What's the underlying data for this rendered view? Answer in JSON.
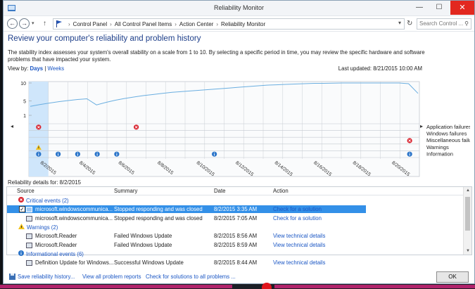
{
  "window": {
    "title": "Reliability Monitor",
    "minimize": "—",
    "maximize": "☐",
    "close": "✕"
  },
  "nav": {
    "back": "←",
    "forward": "→",
    "up": "↑",
    "breadcrumbs": [
      "Control Panel",
      "All Control Panel Items",
      "Action Center",
      "Reliability Monitor"
    ],
    "breadcrumb_sep": "›",
    "search_placeholder": "Search Control ..."
  },
  "header": {
    "title": "Review your computer's reliability and problem history",
    "description": "The stability index assesses your system's overall stability on a scale from 1 to 10. By selecting a specific period in time, you may review the specific hardware and software problems that have impacted your system.",
    "view_by_label": "View by:",
    "view_days": "Days",
    "view_sep": "|",
    "view_weeks": "Weeks",
    "last_updated": "Last updated: 8/21/2015 10:00 AM"
  },
  "chart_data": {
    "type": "line",
    "y_ticks": [
      "10",
      "5",
      "1"
    ],
    "ylim": [
      1,
      10
    ],
    "x_labels": [
      "8/2/2015",
      "8/4/2015",
      "8/6/2015",
      "8/8/2015",
      "8/10/2015",
      "8/12/2015",
      "8/14/2015",
      "8/16/2015",
      "8/18/2015",
      "8/20/2015"
    ],
    "days": 20,
    "series": [
      {
        "values": [
          3.5,
          4.0,
          4.4,
          4.8,
          5.1,
          5.4,
          5.6,
          3.9,
          4.6,
          5.2,
          5.7,
          6.1,
          6.5,
          6.8,
          7.1,
          7.4,
          7.6,
          7.8,
          8.0,
          8.2,
          8.4,
          8.6,
          8.8,
          9.0,
          9.2,
          9.4,
          9.5,
          9.6,
          9.7,
          9.8,
          9.9,
          9.9,
          9.95,
          10.0,
          10.0,
          10.0,
          10.0,
          10.0,
          10.0,
          10.0,
          9.8,
          7.1
        ]
      }
    ],
    "rows": [
      "Application failures",
      "Windows failures",
      "Miscellaneous failures",
      "Warnings",
      "Information"
    ],
    "events": [
      {
        "day": 0,
        "row": 0,
        "kind": "critical"
      },
      {
        "day": 5,
        "row": 0,
        "kind": "critical"
      },
      {
        "day": 19,
        "row": 2,
        "kind": "critical"
      },
      {
        "day": 0,
        "row": 3,
        "kind": "warning"
      },
      {
        "day": 0,
        "row": 4,
        "kind": "info"
      },
      {
        "day": 1,
        "row": 4,
        "kind": "info"
      },
      {
        "day": 2,
        "row": 4,
        "kind": "info"
      },
      {
        "day": 3,
        "row": 4,
        "kind": "info"
      },
      {
        "day": 4,
        "row": 4,
        "kind": "info"
      },
      {
        "day": 9,
        "row": 4,
        "kind": "info"
      },
      {
        "day": 19,
        "row": 4,
        "kind": "info"
      }
    ],
    "selected_day": 0,
    "left_arrow": "◂",
    "right_arrow": "▸",
    "colors": {
      "line": "#6aaee0",
      "selected": "#cfe6fb",
      "grid": "#c4c9cf",
      "critical": "#d9232e",
      "warning": "#f2c21a",
      "info": "#2a74c9"
    }
  },
  "details": {
    "title": "Reliability details for: 8/2/2015",
    "columns": [
      "Source",
      "Summary",
      "Date",
      "Action"
    ],
    "groups": [
      {
        "label": "Critical events (2)",
        "icon": "critical",
        "rows": [
          {
            "source": "microsoft.windowscommunica...",
            "summary": "Stopped responding and was closed",
            "date": "8/2/2015 3:35 AM",
            "action": "Check for a solution",
            "selected": true
          },
          {
            "source": "microsoft.windowscommunica...",
            "summary": "Stopped responding and was closed",
            "date": "8/2/2015 7:05 AM",
            "action": "Check for a solution"
          }
        ]
      },
      {
        "label": "Warnings (2)",
        "icon": "warning",
        "rows": [
          {
            "source": "Microsoft.Reader",
            "summary": "Failed Windows Update",
            "date": "8/2/2015 8:56 AM",
            "action": "View  technical details"
          },
          {
            "source": "Microsoft.Reader",
            "summary": "Failed Windows Update",
            "date": "8/2/2015 8:59 AM",
            "action": "View  technical details"
          }
        ]
      },
      {
        "label": "Informational events (6)",
        "icon": "info",
        "rows": [
          {
            "source": "Definition Update for Windows...",
            "summary": "Successful Windows Update",
            "date": "8/2/2015 8:44 AM",
            "action": "View  technical details"
          }
        ]
      }
    ]
  },
  "footer": {
    "save_history": "Save reliability history...",
    "view_all": "View all problem reports",
    "check_all": "Check for solutions to all problems ...",
    "ok": "OK"
  }
}
